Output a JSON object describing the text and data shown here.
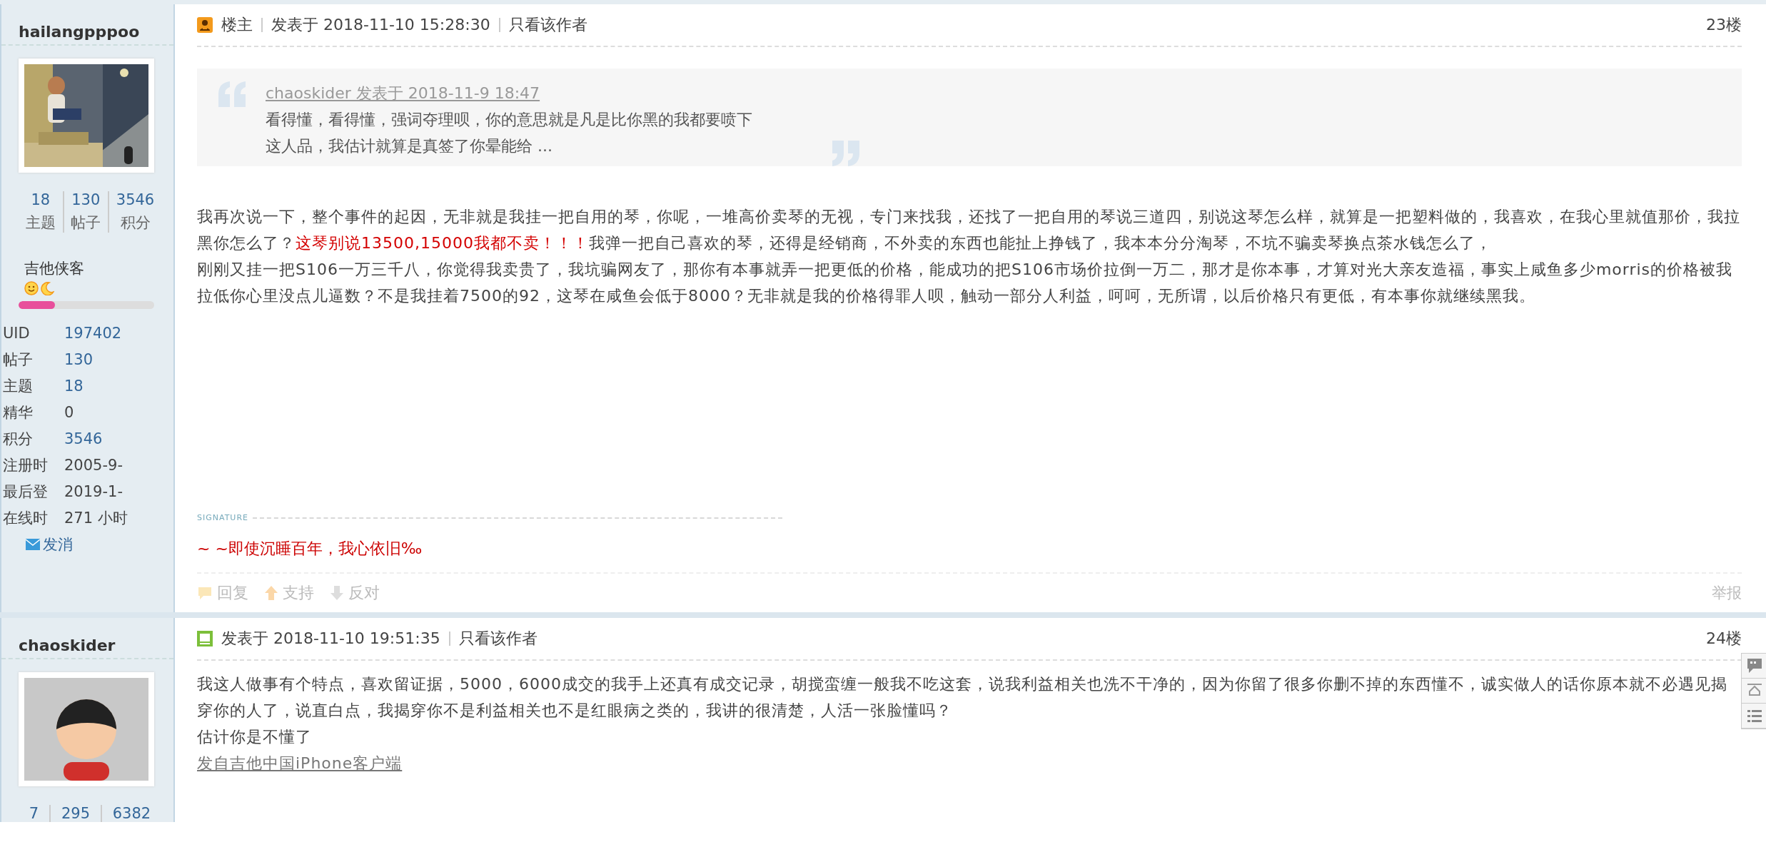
{
  "posts": [
    {
      "author": {
        "name": "hailangpppoo",
        "stats": [
          {
            "value": "18",
            "label": "主题"
          },
          {
            "value": "130",
            "label": "帖子"
          },
          {
            "value": "3546",
            "label": "积分"
          }
        ],
        "rank": "吉他侠客",
        "level": 0.27,
        "info": [
          {
            "label": "UID",
            "value": "197402",
            "link": true
          },
          {
            "label": "帖子",
            "value": "130",
            "link": true
          },
          {
            "label": "主题",
            "value": "18",
            "link": true
          },
          {
            "label": "精华",
            "value": "0",
            "link": false
          },
          {
            "label": "积分",
            "value": "3546",
            "link": true
          },
          {
            "label": "注册时",
            "value": "2005-9-",
            "link": false
          },
          {
            "label": "最后登",
            "value": "2019-1-",
            "link": false
          },
          {
            "label": "在线时",
            "value": "271 小时",
            "link": false
          }
        ],
        "message": "发消"
      },
      "header": {
        "kind": "owner",
        "badge": "楼主",
        "posted": "发表于 2018-11-10 15:28:30",
        "author_only": "只看该作者",
        "floor": "23楼"
      },
      "quote": {
        "source": "chaoskider 发表于 2018-11-9 18:47",
        "lines": [
          "看得懂，看得懂，强词夺理呗，你的意思就是凡是比你黑的我都要喷下",
          "这人品，我估计就算是真签了你晕能给 ..."
        ]
      },
      "body": [
        {
          "segments": [
            {
              "text": "我再次说一下，整个事件的起因，无非就是我挂一把自用的琴，你呢，一堆高价卖琴的无视，专门来找我，还找了一把自用的琴说三道四，别说这琴怎么样，就算是一把塑料做的，我喜欢，在我心里就值那价，我拉黑你怎么了？",
              "highlight": false
            },
            {
              "text": "这琴别说13500,15000我都不卖！！！",
              "highlight": true
            },
            {
              "text": "我弹一把自己喜欢的琴，还得是经销商，不外卖的东西也能扯上挣钱了，我本本分分淘琴，不坑不骗卖琴换点茶水钱怎么了，",
              "highlight": false
            }
          ]
        },
        {
          "segments": [
            {
              "text": "刚刚又挂一把S106一万三千八，你觉得我卖贵了，我坑骗网友了，那你有本事就弄一把更低的价格，能成功的把S106市场价拉倒一万二，那才是你本事，才算对光大亲友造福，事实上咸鱼多少morris的价格被我拉低你心里没点儿逼数？不是我挂着7500的92，这琴在咸鱼会低于8000？无非就是我的价格得罪人呗，触动一部分人利益，呵呵，无所谓，以后价格只有更低，有本事你就继续黑我。",
              "highlight": false
            }
          ]
        }
      ],
      "signature": {
        "label": "SIGNATURE",
        "text": "~ ~即使沉睡百年，我心依旧‰"
      },
      "actions": [
        {
          "kind": "reply",
          "label": "回复"
        },
        {
          "kind": "support",
          "label": "支持"
        },
        {
          "kind": "oppose",
          "label": "反对"
        }
      ],
      "report": "举报"
    },
    {
      "author": {
        "name": "chaoskider",
        "avatar": {
          "kind": "avatar"
        },
        "stats": [
          {
            "value": "7"
          },
          {
            "value": "295"
          },
          {
            "value": "6382"
          }
        ]
      },
      "header": {
        "kind": "post",
        "posted": "发表于 2018-11-10 19:51:35",
        "author_only": "只看该作者",
        "floor": "24楼"
      },
      "body": [
        {
          "segments": [
            {
              "text": "我这人做事有个特点，喜欢留证据，5000，6000成交的我手上还真有成交记录，胡搅蛮缠一般我不吃这套，说我利益相关也洗不干净的，因为你留了很多你删不掉的东西懂不，诚实做人的话你原本就不必遇见揭穿你的人了，说直白点，我揭穿你不是利益相关也不是红眼病之类的，我讲的很清楚，人活一张脸懂吗？",
              "highlight": false
            }
          ]
        },
        {
          "segments": [
            {
              "text": "估计你是不懂了",
              "highlight": false
            }
          ]
        }
      ],
      "client_link": "发自吉他中国iPhone客户端"
    }
  ],
  "side_tools": [
    {
      "kind": "comment"
    },
    {
      "kind": "top"
    },
    {
      "kind": "list"
    }
  ]
}
